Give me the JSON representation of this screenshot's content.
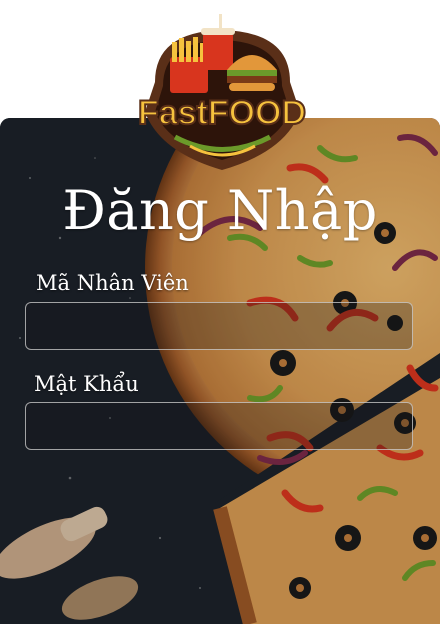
{
  "logo": {
    "text": "FastFOOD",
    "icon": "fast-food-logo"
  },
  "login": {
    "title": "Đăng Nhập",
    "employee_id": {
      "label": "Mã Nhân Viên",
      "value": "",
      "placeholder": ""
    },
    "password": {
      "label": "Mật Khẩu",
      "value": "",
      "placeholder": ""
    }
  },
  "colors": {
    "background": "#1c2229",
    "text": "#ffffff",
    "field_border": "#d2d2d2",
    "logo_brown": "#5a2f18",
    "logo_yellow": "#f6c23e"
  }
}
